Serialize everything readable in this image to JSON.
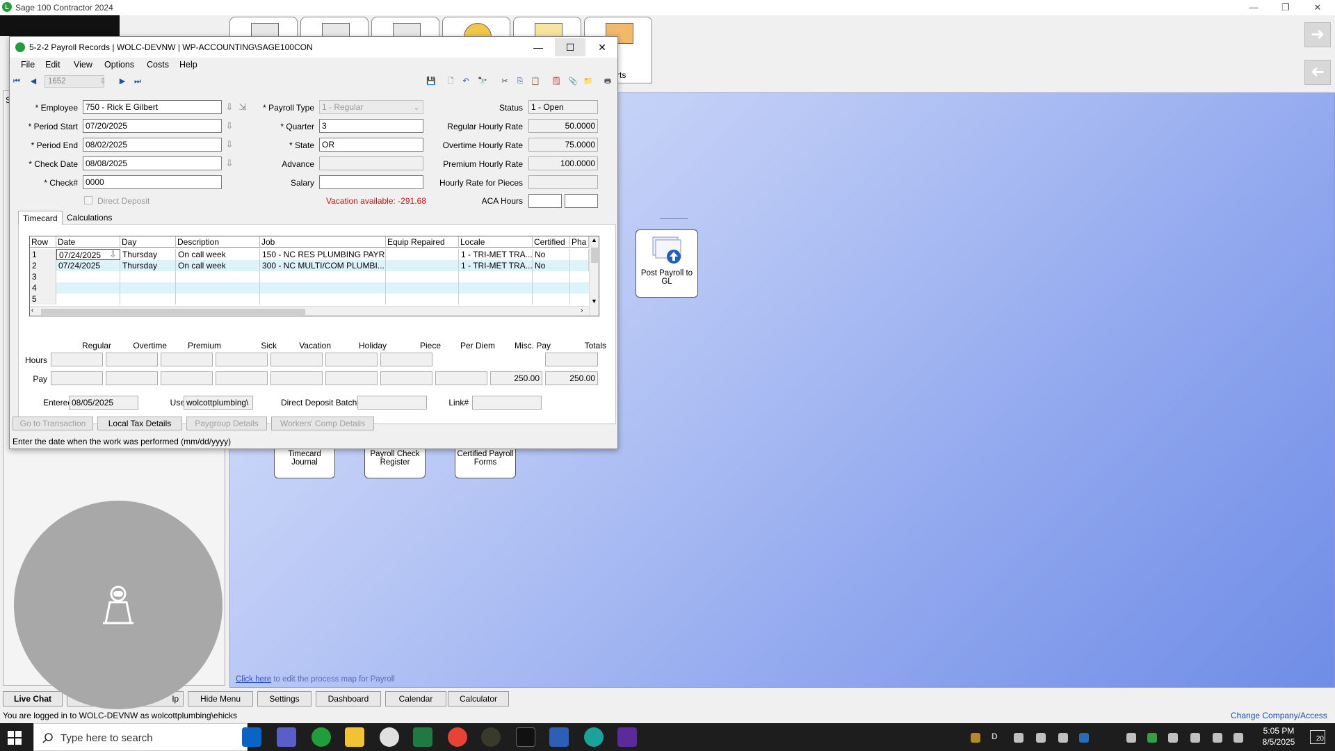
{
  "app": {
    "title": "Sage 100 Contractor 2024",
    "logo_text": "L"
  },
  "left_panel": {
    "label": "S"
  },
  "process_map": {
    "post_gl": "Post Payroll to GL",
    "timecard_journal": "Timecard Journal",
    "payroll_check_register": "Payroll Check Register",
    "certified_payroll_forms": "Certified Payroll Forms",
    "reports_tab_label": "rts",
    "click_here_link": "Click here",
    "click_here_rest": "to edit the process map for Payroll"
  },
  "bottom_buttons": {
    "live_chat": "Live Chat",
    "help": "lp",
    "hide_menu": "Hide Menu",
    "settings": "Settings",
    "dashboard": "Dashboard",
    "calendar": "Calendar",
    "calculator": "Calculator"
  },
  "status_line": "You are logged in to WOLC-DEVNW as wolcottplumbing\\ehicks",
  "change_company": "Change Company/Access",
  "taskbar": {
    "search_placeholder": "Type here to search",
    "time": "5:05 PM",
    "date": "8/5/2025",
    "notifications": "20",
    "tray_letter": "D"
  },
  "dialog": {
    "title": "5-2-2 Payroll Records  |  WOLC-DEVNW  |  WP-ACCOUNTING\\SAGE100CON",
    "menu": [
      "File",
      "Edit",
      "View",
      "Options",
      "Costs",
      "Help"
    ],
    "record_number": "1652",
    "fields": {
      "employee_label": "* Employee",
      "employee": "750 - Rick E Gilbert",
      "period_start_label": "* Period Start",
      "period_start": "07/20/2025",
      "period_end_label": "* Period End",
      "period_end": "08/02/2025",
      "check_date_label": "* Check Date",
      "check_date": "08/08/2025",
      "check_no_label": "* Check#",
      "check_no": "0000",
      "direct_deposit_label": "Direct Deposit",
      "payroll_type_label": "* Payroll Type",
      "payroll_type": "1 - Regular",
      "quarter_label": "* Quarter",
      "quarter": "3",
      "state_label": "* State",
      "state": "OR",
      "advance_label": "Advance",
      "advance": "",
      "salary_label": "Salary",
      "salary": "",
      "vacation_available": "Vacation available:  -291.68",
      "status_label": "Status",
      "status": "1 - Open",
      "regular_rate_label": "Regular Hourly Rate",
      "regular_rate": "50.0000",
      "overtime_rate_label": "Overtime Hourly Rate",
      "overtime_rate": "75.0000",
      "premium_rate_label": "Premium Hourly Rate",
      "premium_rate": "100.0000",
      "piece_rate_label": "Hourly Rate for Pieces",
      "piece_rate": "",
      "aca_hours_label": "ACA Hours"
    },
    "tabs": [
      "Timecard",
      "Calculations"
    ],
    "grid": {
      "columns": [
        "Row",
        "Date",
        "Day",
        "Description",
        "Job",
        "Equip Repaired",
        "Locale",
        "Certified",
        "Pha"
      ],
      "rows": [
        {
          "row": "1",
          "date": "07/24/2025",
          "day": "Thursday",
          "description": "On call week",
          "job": "150 - NC RES PLUMBING PAYR...",
          "equip": "",
          "locale": "1 - TRI-MET TRA...",
          "certified": "No"
        },
        {
          "row": "2",
          "date": "07/24/2025",
          "day": "Thursday",
          "description": "On call week",
          "job": "300 - NC MULTI/COM PLUMBI...",
          "equip": "",
          "locale": "1 - TRI-MET TRA...",
          "certified": "No"
        },
        {
          "row": "3",
          "date": "",
          "day": "",
          "description": "",
          "job": "",
          "equip": "",
          "locale": "",
          "certified": ""
        },
        {
          "row": "4",
          "date": "",
          "day": "",
          "description": "",
          "job": "",
          "equip": "",
          "locale": "",
          "certified": ""
        },
        {
          "row": "5",
          "date": "",
          "day": "",
          "description": "",
          "job": "",
          "equip": "",
          "locale": "",
          "certified": ""
        }
      ]
    },
    "totals": {
      "headers": [
        "Regular",
        "Overtime",
        "Premium",
        "Sick",
        "Vacation",
        "Holiday",
        "Piece",
        "Per Diem",
        "Misc. Pay",
        "Totals"
      ],
      "hours_label": "Hours",
      "pay_label": "Pay",
      "misc_pay": "250.00",
      "total_pay": "250.00"
    },
    "entered_label": "Entered",
    "entered": "08/05/2025",
    "user_label": "User",
    "user": "wolcottplumbing\\",
    "dd_batch_label": "Direct Deposit Batch#",
    "link_label": "Link#",
    "buttons": {
      "go_to_transaction": "Go to Transaction",
      "local_tax_details": "Local Tax Details",
      "paygroup_details": "Paygroup Details",
      "workers_comp_details": "Workers' Comp Details"
    },
    "status_hint": "Enter the date when the work was performed (mm/dd/yyyy)"
  }
}
